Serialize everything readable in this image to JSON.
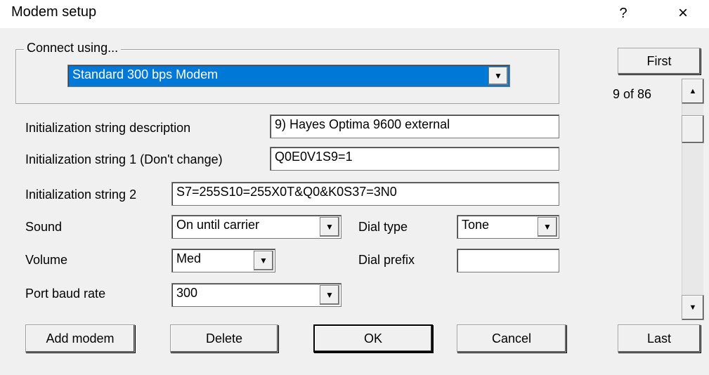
{
  "window": {
    "title": "Modem setup",
    "help_label": "?",
    "close_label": "×"
  },
  "connect": {
    "group_label": "Connect using...",
    "modem_selected": "Standard   300 bps Modem"
  },
  "fields": {
    "init_desc_label": "Initialization string description",
    "init_desc_value": "9) Hayes Optima 9600 external",
    "init1_label": "Initialization string 1 (Don't change)",
    "init1_value": "Q0E0V1S9=1",
    "init2_label": "Initialization string 2",
    "init2_value": "S7=255S10=255X0T&Q0&K0S37=3N0",
    "sound_label": "Sound",
    "sound_value": "On until carrier",
    "dial_type_label": "Dial type",
    "dial_type_value": "Tone",
    "volume_label": "Volume",
    "volume_value": "Med",
    "dial_prefix_label": "Dial prefix",
    "dial_prefix_value": "",
    "baud_label": "Port baud rate",
    "baud_value": "300"
  },
  "navigation": {
    "first_label": "First",
    "position_text": "9 of 86",
    "last_label": "Last"
  },
  "buttons": {
    "add_modem": "Add modem",
    "delete": "Delete",
    "ok": "OK",
    "cancel": "Cancel"
  },
  "icons": {
    "dropdown": "chevron-down-icon",
    "scroll_up": "scroll-up-icon",
    "scroll_down": "scroll-down-icon",
    "close": "close-icon"
  },
  "colors": {
    "selection": "#0078d7",
    "dialog_bg": "#f0f0f0"
  }
}
